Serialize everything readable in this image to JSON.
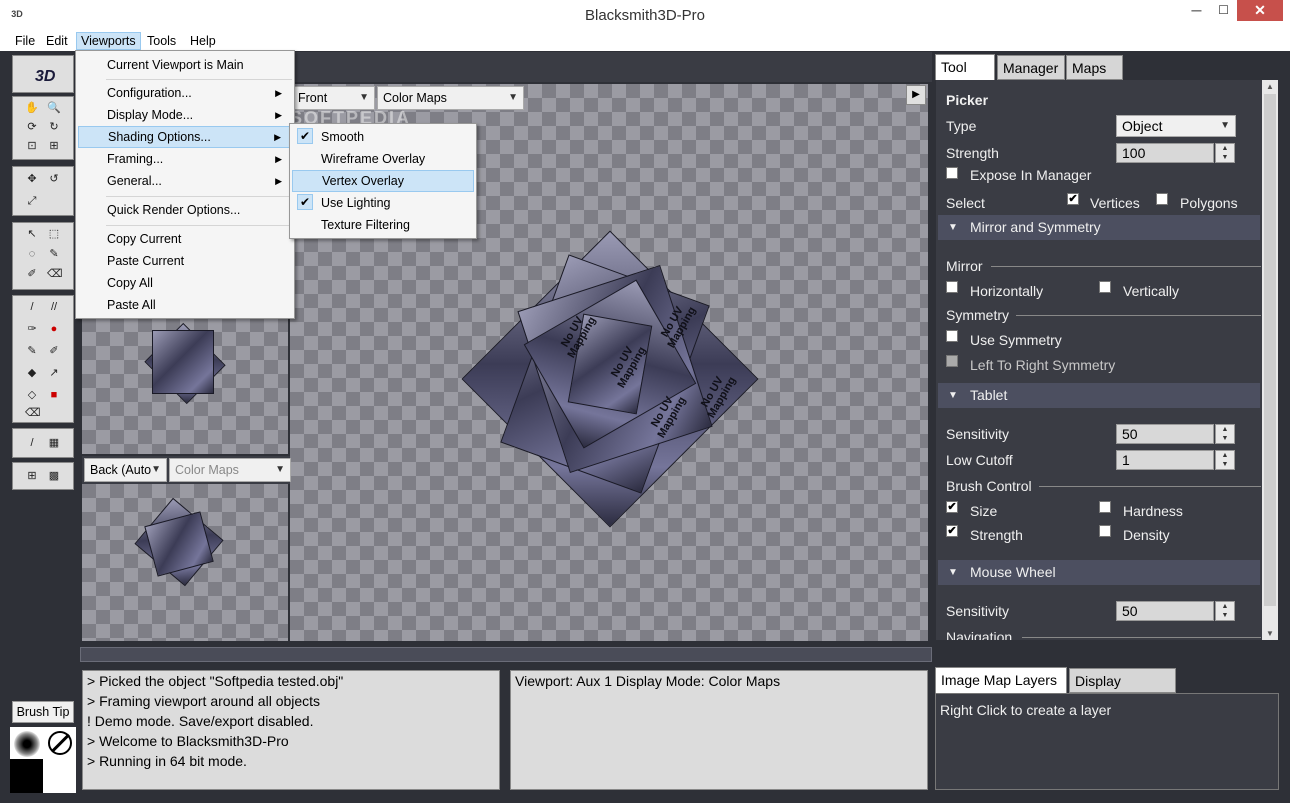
{
  "window": {
    "title": "Blacksmith3D-Pro",
    "icon_label": "3D",
    "minimize": "─",
    "maximize": "☐",
    "close": "✕"
  },
  "menubar": [
    "File",
    "Edit",
    "Viewports",
    "Tools",
    "Help"
  ],
  "viewports_menu": {
    "items": [
      "Current Viewport is Main",
      "Configuration...",
      "Display Mode...",
      "Shading Options...",
      "Framing...",
      "General...",
      "Quick Render Options...",
      "Copy Current",
      "Paste Current",
      "Copy All",
      "Paste All"
    ],
    "highlighted": "Shading Options..."
  },
  "shading_submenu": {
    "items": [
      "Smooth",
      "Wireframe Overlay",
      "Vertex Overlay",
      "Use Lighting",
      "Texture Filtering"
    ],
    "checked": [
      "Smooth",
      "Use Lighting"
    ],
    "highlighted": "Vertex Overlay"
  },
  "main_viewport": {
    "view": "Front",
    "display_mode": "Color Maps",
    "play_glyph": "▶"
  },
  "aux_viewport": {
    "view": "Back (Auto",
    "display_mode": "Color Maps"
  },
  "watermark": "SOFTPEDIA",
  "mesh_text": [
    "No UV Mapping",
    "No UV Mapping",
    "No UV Mapping",
    "No UV Mapping",
    "No UV Mapping"
  ],
  "toolbar": {
    "logo": "3D",
    "brush_tip": "Brush Tip"
  },
  "console": {
    "log": [
      "> Picked the object \"Softpedia tested.obj\"",
      "> Framing viewport around all objects",
      "! Demo mode. Save/export disabled.",
      "> Welcome to Blacksmith3D-Pro",
      "> Running in 64 bit mode."
    ],
    "status": "Viewport: Aux 1 Display Mode: Color Maps"
  },
  "right_panel": {
    "tabs": [
      "Tool",
      "Manager",
      "Maps"
    ],
    "tool_name": "Picker",
    "type_label": "Type",
    "type_value": "Object",
    "strength_label": "Strength",
    "strength_value": "100",
    "expose_label": "Expose In Manager",
    "select_label": "Select",
    "vertices_label": "Vertices",
    "polygons_label": "Polygons",
    "mirror_section": "Mirror and Symmetry",
    "mirror_group": "Mirror",
    "horizontally": "Horizontally",
    "vertically": "Vertically",
    "symmetry_group": "Symmetry",
    "use_symmetry": "Use Symmetry",
    "ltr_symmetry": "Left To Right Symmetry",
    "tablet_section": "Tablet",
    "sensitivity_label": "Sensitivity",
    "sensitivity_value": "50",
    "low_cutoff_label": "Low Cutoff",
    "low_cutoff_value": "1",
    "brush_control_group": "Brush Control",
    "size_label": "Size",
    "hardness_label": "Hardness",
    "strength2_label": "Strength",
    "density_label": "Density",
    "mouse_wheel_section": "Mouse Wheel",
    "mw_sensitivity_label": "Sensitivity",
    "mw_sensitivity_value": "50",
    "navigation_group": "Navigation"
  },
  "layers_panel": {
    "tabs": [
      "Image Map Layers",
      "Display Groups"
    ],
    "hint": "Right Click to create a layer"
  }
}
